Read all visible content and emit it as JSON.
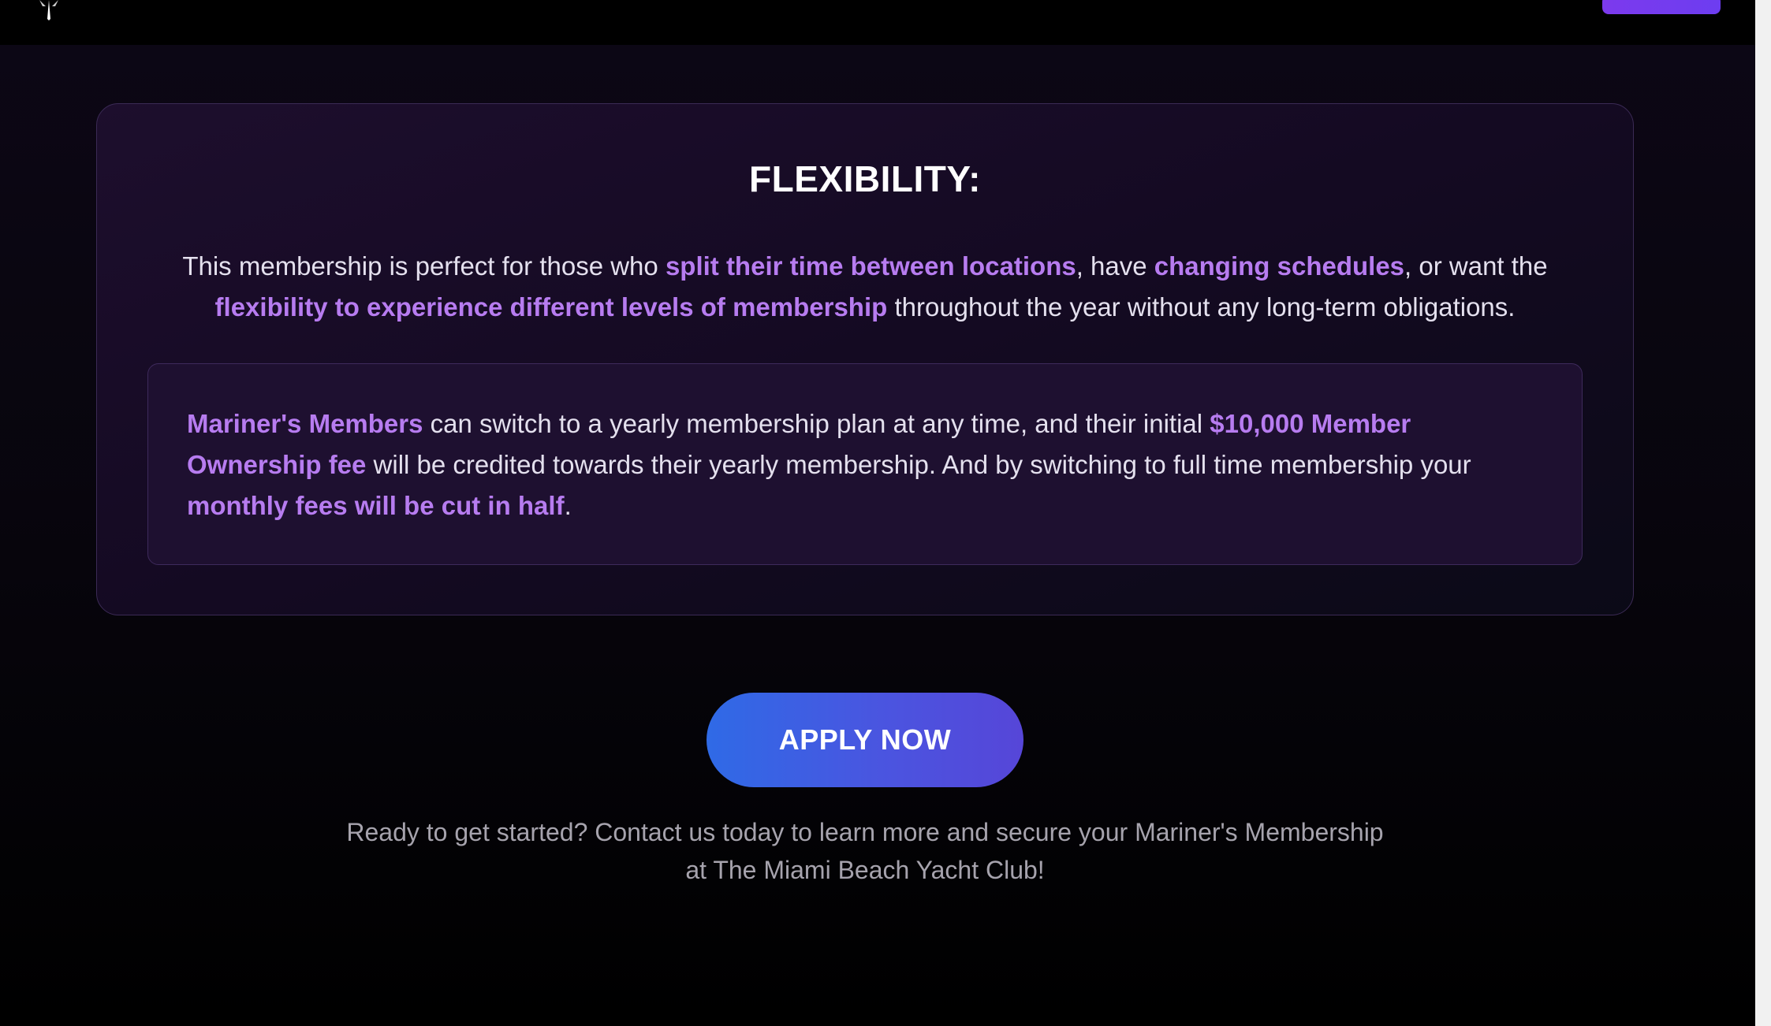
{
  "header": {
    "logo_icon": "sailboat-logo-icon",
    "action_button_color": "#7c3aed"
  },
  "card": {
    "title": "FLEXIBILITY:",
    "intro": {
      "part1": "This membership is perfect for those who ",
      "highlight1": "split their time between locations",
      "part2": ", have ",
      "highlight2": "changing schedules",
      "part3": ", or want the ",
      "highlight3": "flexibility to experience different levels of membership",
      "part4": " throughout the year without any long-term obligations."
    },
    "note": {
      "highlight1": "Mariner's Members",
      "part1": " can switch to a yearly membership plan at any time, and their initial ",
      "highlight2": "$10,000 Member Ownership fee",
      "part2": " will be credited towards their yearly membership. And by switching to full time membership your ",
      "highlight3": "monthly fees will be cut in half",
      "part3": "."
    }
  },
  "cta": {
    "button_label": "APPLY NOW",
    "text_line1": "Ready to get started? Contact us today to learn more and secure your Mariner's Membership",
    "text_line2": "at The Miami Beach Yacht Club!"
  },
  "colors": {
    "highlight": "#b77cf0",
    "button_gradient_start": "#2f6ae6",
    "button_gradient_end": "#5646d8",
    "background": "#07050c"
  }
}
